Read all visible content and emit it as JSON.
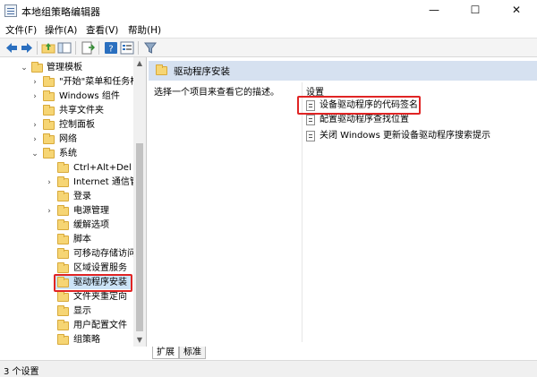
{
  "window": {
    "title": "本地组策略编辑器",
    "min_glyph": "—",
    "max_glyph": "☐",
    "close_glyph": "✕"
  },
  "menu": {
    "file": "文件(F)",
    "action": "操作(A)",
    "view": "查看(V)",
    "help": "帮助(H)"
  },
  "toolbar": {
    "icons": [
      "back-icon",
      "forward-icon",
      "up-folder-icon",
      "show-hide-tree-icon",
      "export-list-icon",
      "help-icon",
      "properties-icon",
      "filter-icon"
    ]
  },
  "tree": {
    "items": [
      {
        "label": "管理模板",
        "expand": "⌄"
      },
      {
        "label": "\"开始\"菜单和任务栏",
        "expand": "›"
      },
      {
        "label": "Windows 组件",
        "expand": "›"
      },
      {
        "label": "共享文件夹",
        "expand": ""
      },
      {
        "label": "控制面板",
        "expand": "›"
      },
      {
        "label": "网络",
        "expand": "›"
      },
      {
        "label": "系统",
        "expand": "⌄"
      },
      {
        "label": "Ctrl+Alt+Del 选项",
        "expand": ""
      },
      {
        "label": "Internet 通信管理",
        "expand": "›"
      },
      {
        "label": "登录",
        "expand": ""
      },
      {
        "label": "电源管理",
        "expand": "›"
      },
      {
        "label": "缓解选项",
        "expand": ""
      },
      {
        "label": "脚本",
        "expand": ""
      },
      {
        "label": "可移动存储访问",
        "expand": ""
      },
      {
        "label": "区域设置服务",
        "expand": ""
      },
      {
        "label": "驱动程序安装",
        "expand": "",
        "selected": true
      },
      {
        "label": "文件夹重定向",
        "expand": ""
      },
      {
        "label": "显示",
        "expand": ""
      },
      {
        "label": "用户配置文件",
        "expand": ""
      },
      {
        "label": "组策略",
        "expand": ""
      }
    ],
    "scroll_up": "▲",
    "scroll_down": "▼"
  },
  "main": {
    "header": "驱动程序安装",
    "description": "选择一个项目来查看它的描述。",
    "settings_header": "设置",
    "settings": [
      "设备驱动程序的代码签名",
      "配置驱动程序查找位置",
      "关闭 Windows 更新设备驱动程序搜索提示"
    ]
  },
  "tabs": {
    "extended": "扩展",
    "standard": "标准"
  },
  "status": {
    "text": "3 个设置"
  },
  "colors": {
    "highlight_border": "#e02424",
    "header_bg": "#d6e1f0",
    "folder": "#f6d574"
  }
}
